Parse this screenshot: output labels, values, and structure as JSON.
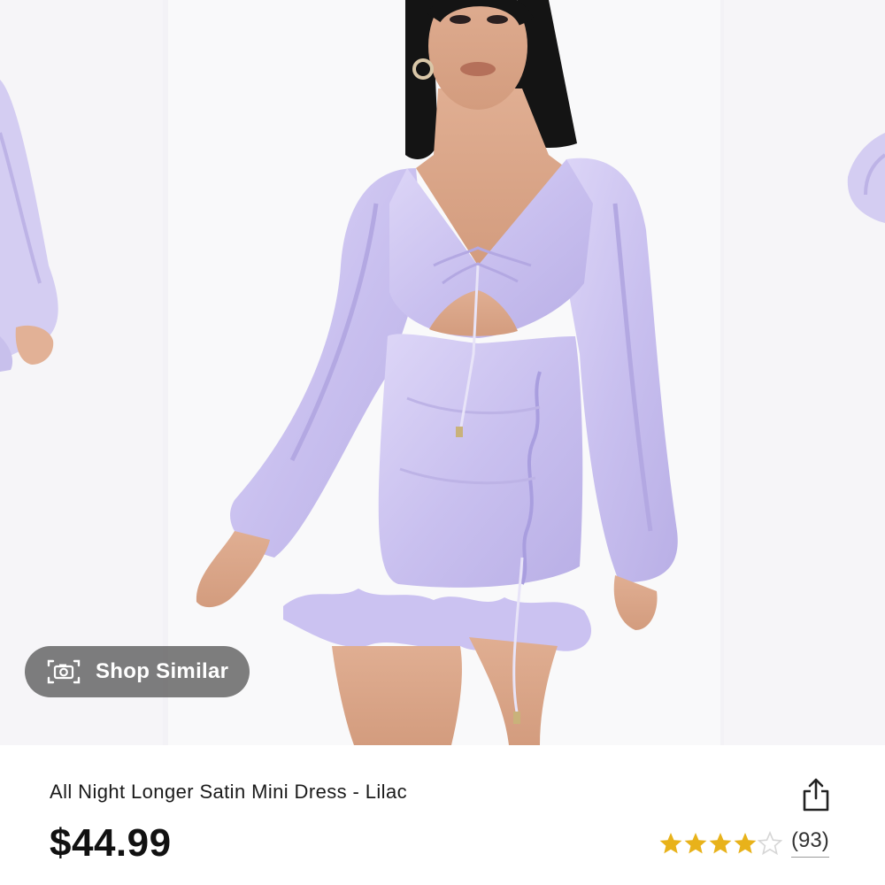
{
  "carousel": {
    "images": [
      {
        "name": "Previous product photo"
      },
      {
        "name": "Main product photo"
      },
      {
        "name": "Next product photo"
      }
    ],
    "shop_similar_label": "Shop Similar",
    "shop_similar_icon": "camera-icon"
  },
  "product": {
    "title": "All Night Longer Satin Mini Dress - Lilac",
    "price": "$44.99",
    "rating": 4,
    "rating_max": 5,
    "review_count": "(93)",
    "share_icon": "share-icon"
  },
  "colors": {
    "star_filled": "#e8b21a",
    "star_empty": "#d6d6d6",
    "dress": "#cfc7f0",
    "pill": "#5a5a5a"
  }
}
